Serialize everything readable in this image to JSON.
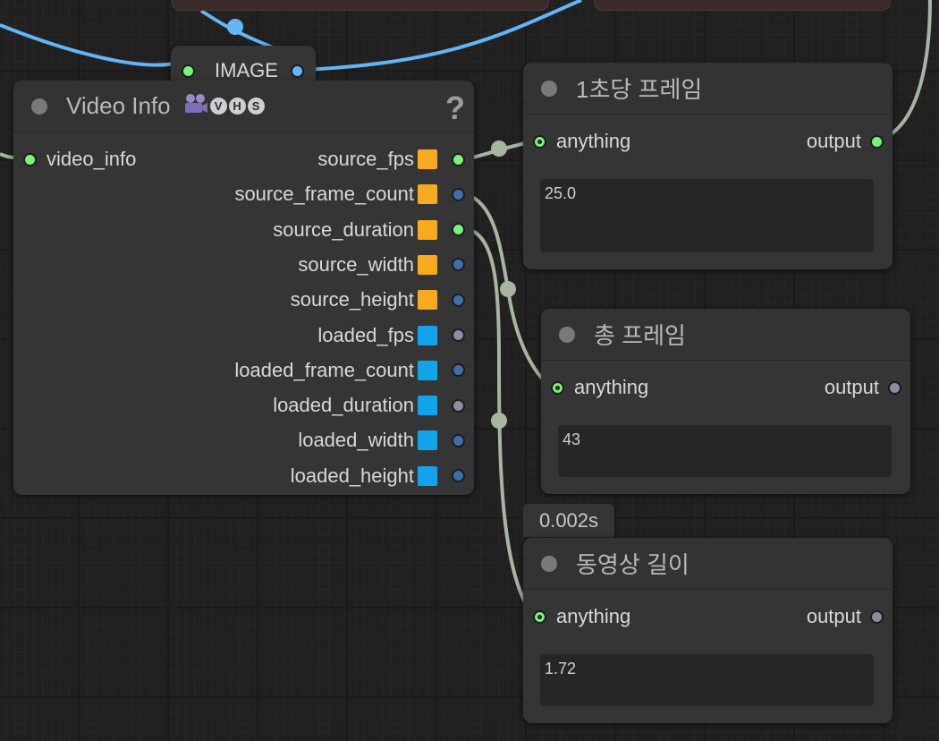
{
  "colors": {
    "image_wire": "#64b5f6",
    "generic_wire": "#a6b6a0",
    "source_square": "#f7a91f",
    "loaded_square": "#12a4eb",
    "green_slot": "#7af37a",
    "blue_slot": "#3e6fa8",
    "gray_slot": "#8c8ca3"
  },
  "image_node": {
    "title": "IMAGE"
  },
  "video_info_node": {
    "title": "Video Info",
    "icons": [
      "film-camera-icon",
      "v-circle-icon",
      "h-circle-icon",
      "s-circle-icon"
    ],
    "badges": [
      "V",
      "H",
      "S"
    ],
    "help": "?",
    "input": "video_info",
    "outputs": [
      {
        "label": "source_fps",
        "kind": "source",
        "slot": "green"
      },
      {
        "label": "source_frame_count",
        "kind": "source",
        "slot": "blue"
      },
      {
        "label": "source_duration",
        "kind": "source",
        "slot": "green"
      },
      {
        "label": "source_width",
        "kind": "source",
        "slot": "blue"
      },
      {
        "label": "source_height",
        "kind": "source",
        "slot": "blue"
      },
      {
        "label": "loaded_fps",
        "kind": "loaded",
        "slot": "gray"
      },
      {
        "label": "loaded_frame_count",
        "kind": "loaded",
        "slot": "blue"
      },
      {
        "label": "loaded_duration",
        "kind": "loaded",
        "slot": "gray"
      },
      {
        "label": "loaded_width",
        "kind": "loaded",
        "slot": "blue"
      },
      {
        "label": "loaded_height",
        "kind": "loaded",
        "slot": "blue"
      }
    ]
  },
  "fps_node": {
    "title": "1초당 프레임",
    "input": "anything",
    "output": "output",
    "value": "25.0"
  },
  "frames_node": {
    "title": "총 프레임",
    "input": "anything",
    "output": "output",
    "value": "43"
  },
  "timing_badge": "0.002s",
  "duration_node": {
    "title": "동영상 길이",
    "input": "anything",
    "output": "output",
    "value": "1.72"
  }
}
